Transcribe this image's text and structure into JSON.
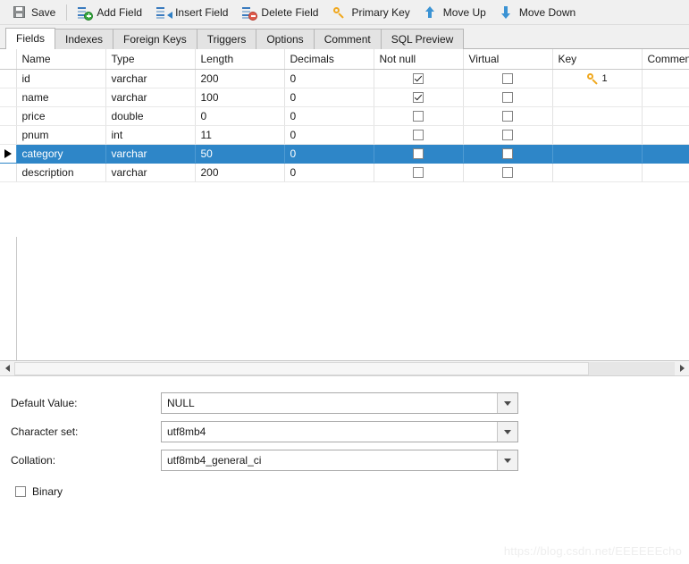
{
  "toolbar": {
    "buttons": [
      {
        "label": "Save",
        "icon": "save-icon"
      },
      {
        "label": "Add Field",
        "icon": "add-field-icon"
      },
      {
        "label": "Insert Field",
        "icon": "insert-field-icon"
      },
      {
        "label": "Delete Field",
        "icon": "delete-field-icon"
      },
      {
        "label": "Primary Key",
        "icon": "primary-key-icon"
      },
      {
        "label": "Move Up",
        "icon": "arrow-up-icon"
      },
      {
        "label": "Move Down",
        "icon": "arrow-down-icon"
      }
    ]
  },
  "tabs": {
    "active": "Fields",
    "items": [
      {
        "label": "Fields"
      },
      {
        "label": "Indexes"
      },
      {
        "label": "Foreign Keys"
      },
      {
        "label": "Triggers"
      },
      {
        "label": "Options"
      },
      {
        "label": "Comment"
      },
      {
        "label": "SQL Preview"
      }
    ]
  },
  "grid": {
    "columns": [
      {
        "label": "Name"
      },
      {
        "label": "Type"
      },
      {
        "label": "Length"
      },
      {
        "label": "Decimals"
      },
      {
        "label": "Not null"
      },
      {
        "label": "Virtual"
      },
      {
        "label": "Key"
      },
      {
        "label": "Comment"
      }
    ],
    "rows": [
      {
        "name": "id",
        "type": "varchar",
        "length": "200",
        "decimals": "0",
        "not_null": true,
        "virtual": false,
        "key": "1",
        "comment": "",
        "selected": false
      },
      {
        "name": "name",
        "type": "varchar",
        "length": "100",
        "decimals": "0",
        "not_null": true,
        "virtual": false,
        "key": "",
        "comment": "",
        "selected": false
      },
      {
        "name": "price",
        "type": "double",
        "length": "0",
        "decimals": "0",
        "not_null": false,
        "virtual": false,
        "key": "",
        "comment": "",
        "selected": false
      },
      {
        "name": "pnum",
        "type": "int",
        "length": "11",
        "decimals": "0",
        "not_null": false,
        "virtual": false,
        "key": "",
        "comment": "",
        "selected": false
      },
      {
        "name": "category",
        "type": "varchar",
        "length": "50",
        "decimals": "0",
        "not_null": false,
        "virtual": false,
        "key": "",
        "comment": "",
        "selected": true
      },
      {
        "name": "description",
        "type": "varchar",
        "length": "200",
        "decimals": "0",
        "not_null": false,
        "virtual": false,
        "key": "",
        "comment": "",
        "selected": false
      }
    ]
  },
  "form": {
    "default_value": {
      "label": "Default Value:",
      "value": "NULL"
    },
    "character_set": {
      "label": "Character set:",
      "value": "utf8mb4"
    },
    "collation": {
      "label": "Collation:",
      "value": "utf8mb4_general_ci"
    },
    "binary": {
      "label": "Binary",
      "checked": false
    }
  },
  "watermark": {
    "text": "https://blog.csdn.net/EEEEEEcho"
  },
  "colors": {
    "selection": "#2e86c8",
    "toolbar_bg": "#f0f0f0",
    "key_icon": "#f0a81e",
    "accent_blue": "#3b93d4",
    "add_green": "#36a93f",
    "delete_red": "#e05b4c"
  }
}
